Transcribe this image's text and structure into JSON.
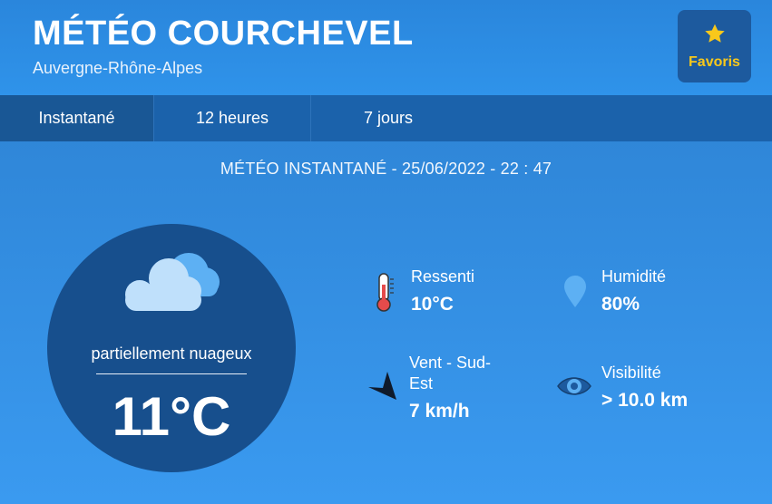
{
  "header": {
    "city": "MÉTÉO COURCHEVEL",
    "region": "Auvergne-Rhône-Alpes",
    "favorites_label": "Favoris"
  },
  "tabs": [
    {
      "label": "Instantané",
      "active": true
    },
    {
      "label": "12 heures",
      "active": false
    },
    {
      "label": "7 jours",
      "active": false
    }
  ],
  "snapshot_title": "MÉTÉO INSTANTANÉ - 25/06/2022 - 22 : 47",
  "current": {
    "condition": "partiellement nuageux",
    "condition_icon": "partly-cloudy-icon",
    "temperature": "11°C"
  },
  "stats": {
    "feels_like": {
      "label": "Ressenti",
      "value": "10°C",
      "icon": "thermometer-icon"
    },
    "humidity": {
      "label": "Humidité",
      "value": "80%",
      "icon": "water-drop-icon"
    },
    "wind": {
      "label_line1": "Vent - Sud-",
      "label_line2": "Est",
      "value": "7 km/h",
      "icon": "wind-direction-arrow-icon"
    },
    "visibility": {
      "label": "Visibilité",
      "value": "> 10.0 km",
      "icon": "eye-icon"
    }
  },
  "colors": {
    "background": "#3a9af0",
    "tab_bar": "#1b62ab",
    "circle": "#174f8d",
    "favorites_button": "#1d5a9e",
    "favorites_accent": "#f8c81b"
  }
}
